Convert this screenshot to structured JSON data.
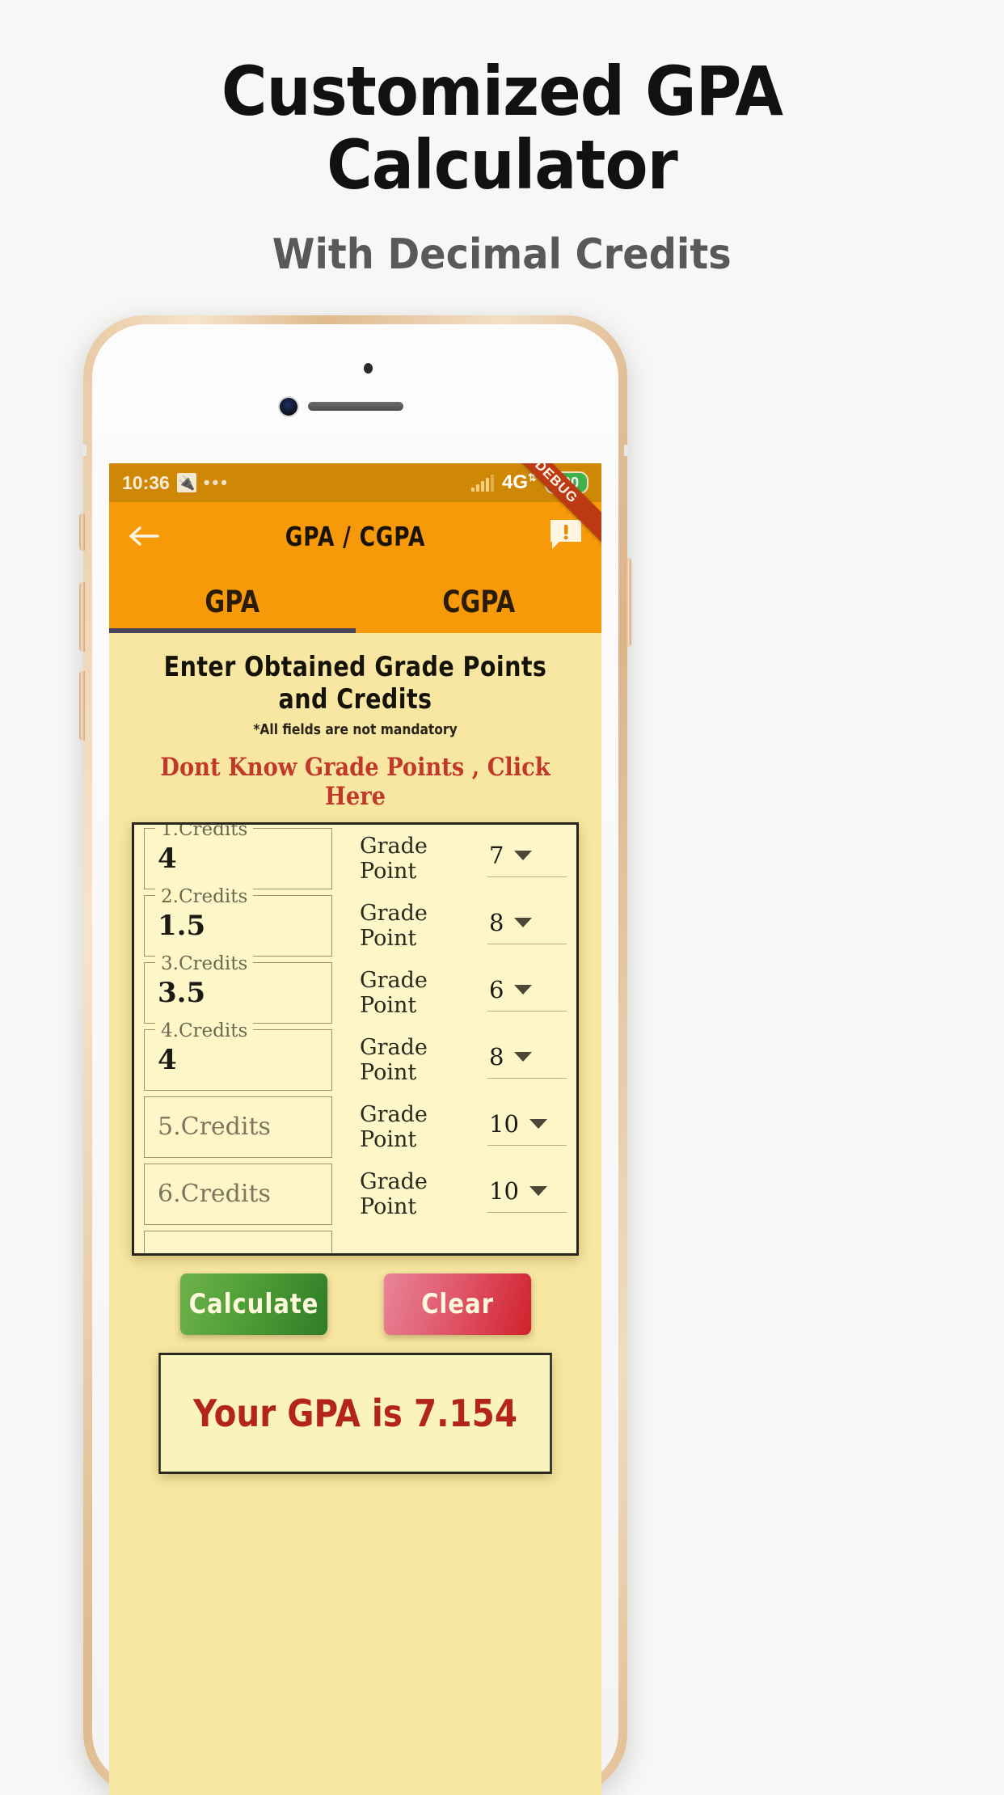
{
  "promo": {
    "title": "Customized GPA Calculator",
    "subtitle": "With Decimal Credits"
  },
  "statusbar": {
    "time": "10:36",
    "usb_icon": "usb-icon",
    "overflow_dots": "•••",
    "network": "4G",
    "network_sup": "⇅",
    "battery": "100",
    "debug_ribbon": "DEBUG"
  },
  "appbar": {
    "back_icon": "arrow-left-icon",
    "title": "GPA / CGPA",
    "feedback_icon": "feedback-icon"
  },
  "tabs": [
    {
      "label": "GPA",
      "selected": true
    },
    {
      "label": "CGPA",
      "selected": false
    }
  ],
  "main": {
    "heading": "Enter Obtained Grade Points and Credits",
    "note": "*All fields are not mandatory",
    "help_link": "Dont Know Grade Points , Click Here",
    "grade_point_label": "Grade Point",
    "rows": [
      {
        "legend": "1.Credits",
        "placeholder": "1.Credits",
        "value": "4",
        "filled": true,
        "grade_point": "7"
      },
      {
        "legend": "2.Credits",
        "placeholder": "2.Credits",
        "value": "1.5",
        "filled": true,
        "grade_point": "8"
      },
      {
        "legend": "3.Credits",
        "placeholder": "3.Credits",
        "value": "3.5",
        "filled": true,
        "grade_point": "6"
      },
      {
        "legend": "4.Credits",
        "placeholder": "4.Credits",
        "value": "4",
        "filled": true,
        "grade_point": "8"
      },
      {
        "legend": "5.Credits",
        "placeholder": "5.Credits",
        "value": "",
        "filled": false,
        "grade_point": "10"
      },
      {
        "legend": "6.Credits",
        "placeholder": "6.Credits",
        "value": "",
        "filled": false,
        "grade_point": "10"
      }
    ]
  },
  "actions": {
    "calculate": "Calculate",
    "clear": "Clear"
  },
  "result": {
    "text": "Your GPA is 7.154"
  },
  "colors": {
    "statusbar": "#cf8806",
    "appbar": "#f79a09",
    "page_bg": "#f7e7a3",
    "card_bg": "#fcf6c8",
    "link": "#c0392b",
    "result": "#b3241d",
    "calculate": "#4f9e38",
    "clear": "#d0212c",
    "battery": "#3fb24a",
    "debug": "#bd3a14"
  }
}
